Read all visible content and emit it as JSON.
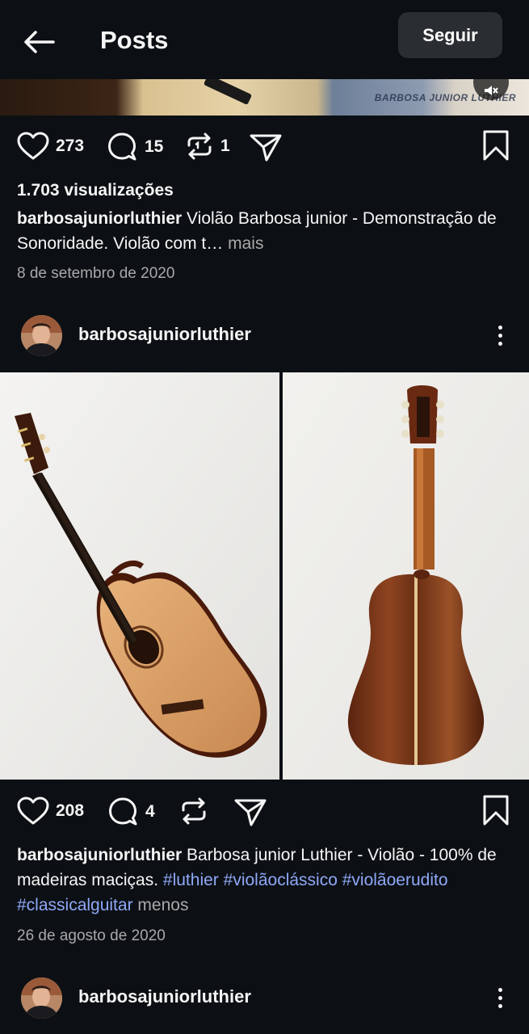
{
  "header": {
    "title": "Posts",
    "follow_label": "Seguir",
    "back_icon": "arrow-left-icon"
  },
  "video_strip": {
    "watermark": "BARBOSA JUNIOR LUTHIER"
  },
  "post1": {
    "likes": "273",
    "comments": "15",
    "reposts": "1",
    "views": "1.703 visualizações",
    "username": "barbosajuniorluthier",
    "caption": "Violão Barbosa junior - Demonstração de Sonoridade. Violão com t…",
    "more_label": "mais",
    "date": "8 de setembro de 2020"
  },
  "post2": {
    "username": "barbosajuniorluthier",
    "likes": "208",
    "comments": "4",
    "caption_text": "Barbosa junior Luthier - Violão - 100% de madeiras maciças.",
    "hashtags": [
      "#luthier",
      "#violãoclássico",
      "#violãoerudito",
      "#classicalguitar"
    ],
    "less_label": "menos",
    "date": "26 de agosto de 2020"
  },
  "post3": {
    "username": "barbosajuniorluthier"
  },
  "colors": {
    "background": "#0c1014",
    "text": "#f5f5f5",
    "muted": "#a8a8a8",
    "hashtag": "#8fa8f8",
    "button": "#2a2d31"
  }
}
